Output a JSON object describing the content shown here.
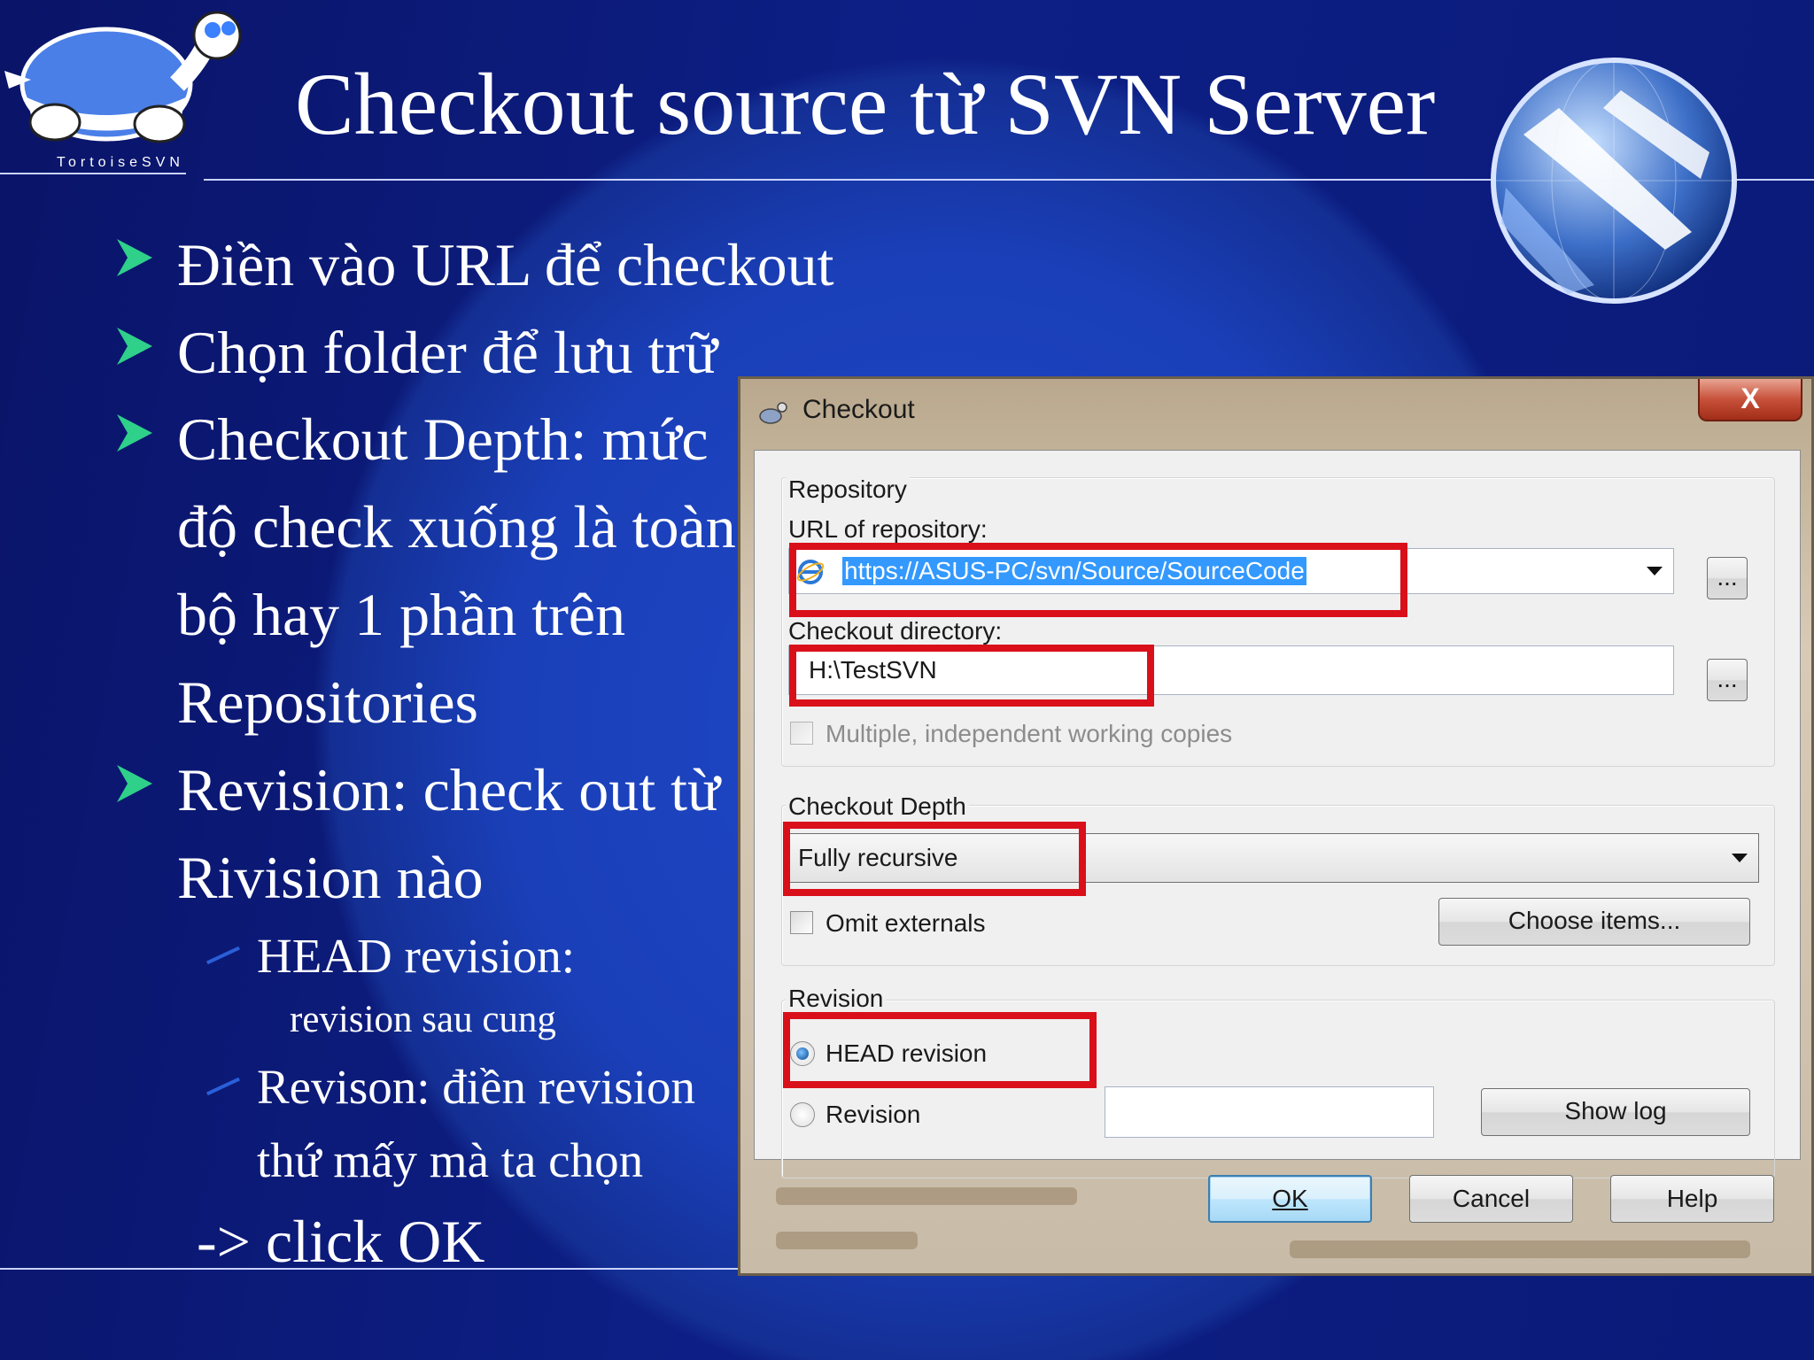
{
  "slide": {
    "title": "Checkout source từ SVN Server",
    "logo_text": "TortoiseSVN",
    "bullets": [
      {
        "lines": [
          "Điền vào URL để checkout"
        ]
      },
      {
        "lines": [
          "Chọn folder để lưu trữ"
        ]
      },
      {
        "lines": [
          "Checkout Depth: mức",
          "độ check xuống là toàn",
          "bộ hay 1 phần trên",
          "Repositories"
        ]
      },
      {
        "lines": [
          "Revision: check out từ",
          "Rivision nào"
        ]
      }
    ],
    "sub_bullets": [
      {
        "title": "HEAD revision:",
        "detail": "revision sau cung"
      },
      {
        "title": "Revison: điền revision",
        "detail": "thứ mấy mà ta chọn"
      }
    ],
    "final": "-> click OK",
    "colors": {
      "background": "#0d1f86",
      "bullet_arrow": "#2fd08a",
      "highlight": "#d9101a"
    }
  },
  "dialog": {
    "title": "Checkout",
    "close_label": "X",
    "repository": {
      "group_label": "Repository",
      "url_label": "URL of repository:",
      "url_value": "https://ASUS-PC/svn/Source/SourceCode",
      "browse_label": "...",
      "dir_label": "Checkout directory:",
      "dir_value": "H:\\TestSVN",
      "dir_browse_label": "...",
      "multiple_label": "Multiple, independent working copies"
    },
    "depth": {
      "group_label": "Checkout Depth",
      "selected": "Fully recursive",
      "omit_label": "Omit externals",
      "choose_label": "Choose items..."
    },
    "revision": {
      "group_label": "Revision",
      "head_label": "HEAD revision",
      "revision_label": "Revision",
      "revision_value": "",
      "show_log_label": "Show log"
    },
    "buttons": {
      "ok": "OK",
      "cancel": "Cancel",
      "help": "Help"
    }
  }
}
